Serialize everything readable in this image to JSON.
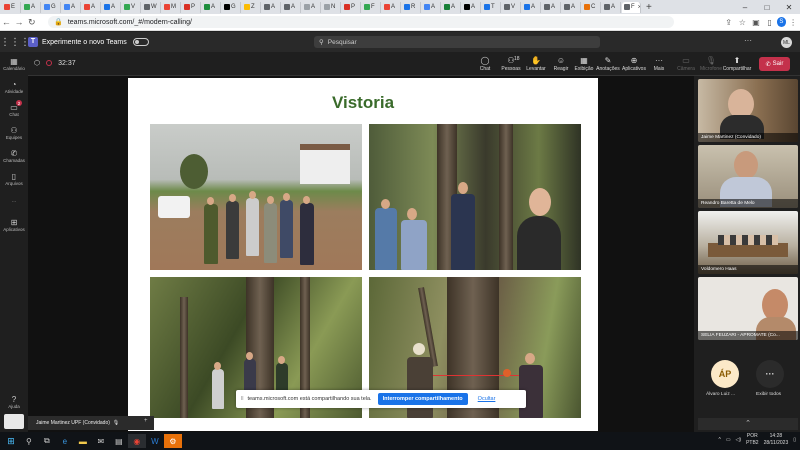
{
  "browser": {
    "tabs": [
      {
        "label": "E",
        "color": "#ea4335"
      },
      {
        "label": "A",
        "color": "#34a853"
      },
      {
        "label": "G",
        "color": "#4285f4"
      },
      {
        "label": "A",
        "color": "#4285f4"
      },
      {
        "label": "A",
        "color": "#ea4335"
      },
      {
        "label": "A",
        "color": "#1a73e8"
      },
      {
        "label": "V",
        "color": "#34a853"
      },
      {
        "label": "W",
        "color": "#5f6368"
      },
      {
        "label": "M",
        "color": "#ea4335"
      },
      {
        "label": "P",
        "color": "#d93025"
      },
      {
        "label": "A",
        "color": "#1e8e3e"
      },
      {
        "label": "G",
        "color": "#000000"
      },
      {
        "label": "Z",
        "color": "#fbbc04"
      },
      {
        "label": "A",
        "color": "#5f6368"
      },
      {
        "label": "A",
        "color": "#5f6368"
      },
      {
        "label": "A",
        "color": "#9aa0a6"
      },
      {
        "label": "N",
        "color": "#9aa0a6"
      },
      {
        "label": "P",
        "color": "#d93025"
      },
      {
        "label": "F",
        "color": "#34a853"
      },
      {
        "label": "A",
        "color": "#ea4335"
      },
      {
        "label": "R",
        "color": "#1a73e8"
      },
      {
        "label": "A",
        "color": "#4285f4"
      },
      {
        "label": "A",
        "color": "#188038"
      },
      {
        "label": "A",
        "color": "#000000"
      },
      {
        "label": "T",
        "color": "#1a73e8"
      },
      {
        "label": "V",
        "color": "#5f6368"
      },
      {
        "label": "A",
        "color": "#1a73e8"
      },
      {
        "label": "A",
        "color": "#5f6368"
      },
      {
        "label": "A",
        "color": "#5f6368"
      },
      {
        "label": "C",
        "color": "#e8710a"
      },
      {
        "label": "A",
        "color": "#5f6368"
      },
      {
        "label": "F",
        "color": "#5f6368"
      }
    ],
    "active_tab_close": "×",
    "new_tab": "+",
    "url": "teams.microsoft.com/_#/modern-calling/",
    "profile_initial": "S",
    "window_controls": {
      "minimize": "–",
      "maximize": "□",
      "close": "✕"
    }
  },
  "teams": {
    "try_new": "Experimente o novo Teams",
    "search_placeholder": "Pesquisar",
    "more": "···",
    "me_initials": "ML",
    "rail": [
      {
        "label": "Calendário",
        "icon": "calendar-icon",
        "glyph": "▦"
      },
      {
        "label": "Atividade",
        "icon": "bell-icon",
        "glyph": "◔"
      },
      {
        "label": "Chat",
        "icon": "chat-icon",
        "glyph": "▭",
        "badge": "2"
      },
      {
        "label": "Equipes",
        "icon": "teams-icon",
        "glyph": "⚇"
      },
      {
        "label": "Chamadas",
        "icon": "phone-icon",
        "glyph": "✆"
      },
      {
        "label": "Arquivos",
        "icon": "file-icon",
        "glyph": "▯"
      },
      {
        "label": "···",
        "icon": "more-icon",
        "glyph": ""
      },
      {
        "label": "Aplicativos",
        "icon": "apps-icon",
        "glyph": "⊞"
      }
    ],
    "help": "Ajuda",
    "meeting": {
      "duration": "32:37",
      "toolbar": [
        {
          "label": "Chat",
          "glyph": "◯"
        },
        {
          "label": "Pessoas",
          "glyph": "⚇",
          "count": "18"
        },
        {
          "label": "Levantar",
          "glyph": "✋"
        },
        {
          "label": "Reagir",
          "glyph": "☺"
        },
        {
          "label": "Exibição",
          "glyph": "▦"
        },
        {
          "label": "Anotações",
          "glyph": "✎"
        },
        {
          "label": "Aplicativos",
          "glyph": "⊕"
        },
        {
          "label": "Mais",
          "glyph": "···"
        },
        {
          "label": "Câmera",
          "glyph": "▭",
          "dim": true
        },
        {
          "label": "Microfone",
          "glyph": "🎙",
          "dim": true
        },
        {
          "label": "Compartilhar",
          "glyph": "⬆"
        }
      ],
      "leave": "Sair"
    },
    "slide": {
      "title": "Vistoria"
    },
    "share_notice": {
      "text": "teams.microsoft.com está compartilhando sua tela.",
      "stop": "Interromper compartilhamento",
      "hide": "Ocultar"
    },
    "self_label": "Jaime Martinez UPF (Convidado)",
    "participants": [
      {
        "name": "Jaime Martinez (Convidado)"
      },
      {
        "name": "Reandro Baretta de Melo"
      },
      {
        "name": "Voldomero Haas"
      },
      {
        "name": "SELIA FEUZARI - APROMATE (Co..."
      }
    ],
    "avatars": [
      {
        "initials": "ÁP",
        "name": "Álvaro Luiz ..."
      },
      {
        "initials": "···",
        "name": "Exibir todos"
      }
    ]
  },
  "taskbar": {
    "lang": "POR",
    "layout": "PTB2",
    "time": "14:28",
    "date": "28/11/2023"
  }
}
